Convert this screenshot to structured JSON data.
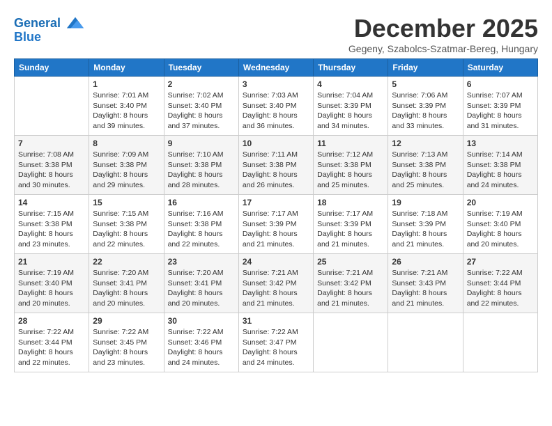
{
  "header": {
    "logo_line1": "General",
    "logo_line2": "Blue",
    "title": "December 2025",
    "subtitle": "Gegeny, Szabolcs-Szatmar-Bereg, Hungary"
  },
  "days_of_week": [
    "Sunday",
    "Monday",
    "Tuesday",
    "Wednesday",
    "Thursday",
    "Friday",
    "Saturday"
  ],
  "weeks": [
    [
      {
        "day": "",
        "info": ""
      },
      {
        "day": "1",
        "info": "Sunrise: 7:01 AM\nSunset: 3:40 PM\nDaylight: 8 hours\nand 39 minutes."
      },
      {
        "day": "2",
        "info": "Sunrise: 7:02 AM\nSunset: 3:40 PM\nDaylight: 8 hours\nand 37 minutes."
      },
      {
        "day": "3",
        "info": "Sunrise: 7:03 AM\nSunset: 3:40 PM\nDaylight: 8 hours\nand 36 minutes."
      },
      {
        "day": "4",
        "info": "Sunrise: 7:04 AM\nSunset: 3:39 PM\nDaylight: 8 hours\nand 34 minutes."
      },
      {
        "day": "5",
        "info": "Sunrise: 7:06 AM\nSunset: 3:39 PM\nDaylight: 8 hours\nand 33 minutes."
      },
      {
        "day": "6",
        "info": "Sunrise: 7:07 AM\nSunset: 3:39 PM\nDaylight: 8 hours\nand 31 minutes."
      }
    ],
    [
      {
        "day": "7",
        "info": "Sunrise: 7:08 AM\nSunset: 3:38 PM\nDaylight: 8 hours\nand 30 minutes."
      },
      {
        "day": "8",
        "info": "Sunrise: 7:09 AM\nSunset: 3:38 PM\nDaylight: 8 hours\nand 29 minutes."
      },
      {
        "day": "9",
        "info": "Sunrise: 7:10 AM\nSunset: 3:38 PM\nDaylight: 8 hours\nand 28 minutes."
      },
      {
        "day": "10",
        "info": "Sunrise: 7:11 AM\nSunset: 3:38 PM\nDaylight: 8 hours\nand 26 minutes."
      },
      {
        "day": "11",
        "info": "Sunrise: 7:12 AM\nSunset: 3:38 PM\nDaylight: 8 hours\nand 25 minutes."
      },
      {
        "day": "12",
        "info": "Sunrise: 7:13 AM\nSunset: 3:38 PM\nDaylight: 8 hours\nand 25 minutes."
      },
      {
        "day": "13",
        "info": "Sunrise: 7:14 AM\nSunset: 3:38 PM\nDaylight: 8 hours\nand 24 minutes."
      }
    ],
    [
      {
        "day": "14",
        "info": "Sunrise: 7:15 AM\nSunset: 3:38 PM\nDaylight: 8 hours\nand 23 minutes."
      },
      {
        "day": "15",
        "info": "Sunrise: 7:15 AM\nSunset: 3:38 PM\nDaylight: 8 hours\nand 22 minutes."
      },
      {
        "day": "16",
        "info": "Sunrise: 7:16 AM\nSunset: 3:38 PM\nDaylight: 8 hours\nand 22 minutes."
      },
      {
        "day": "17",
        "info": "Sunrise: 7:17 AM\nSunset: 3:39 PM\nDaylight: 8 hours\nand 21 minutes."
      },
      {
        "day": "18",
        "info": "Sunrise: 7:17 AM\nSunset: 3:39 PM\nDaylight: 8 hours\nand 21 minutes."
      },
      {
        "day": "19",
        "info": "Sunrise: 7:18 AM\nSunset: 3:39 PM\nDaylight: 8 hours\nand 21 minutes."
      },
      {
        "day": "20",
        "info": "Sunrise: 7:19 AM\nSunset: 3:40 PM\nDaylight: 8 hours\nand 20 minutes."
      }
    ],
    [
      {
        "day": "21",
        "info": "Sunrise: 7:19 AM\nSunset: 3:40 PM\nDaylight: 8 hours\nand 20 minutes."
      },
      {
        "day": "22",
        "info": "Sunrise: 7:20 AM\nSunset: 3:41 PM\nDaylight: 8 hours\nand 20 minutes."
      },
      {
        "day": "23",
        "info": "Sunrise: 7:20 AM\nSunset: 3:41 PM\nDaylight: 8 hours\nand 20 minutes."
      },
      {
        "day": "24",
        "info": "Sunrise: 7:21 AM\nSunset: 3:42 PM\nDaylight: 8 hours\nand 21 minutes."
      },
      {
        "day": "25",
        "info": "Sunrise: 7:21 AM\nSunset: 3:42 PM\nDaylight: 8 hours\nand 21 minutes."
      },
      {
        "day": "26",
        "info": "Sunrise: 7:21 AM\nSunset: 3:43 PM\nDaylight: 8 hours\nand 21 minutes."
      },
      {
        "day": "27",
        "info": "Sunrise: 7:22 AM\nSunset: 3:44 PM\nDaylight: 8 hours\nand 22 minutes."
      }
    ],
    [
      {
        "day": "28",
        "info": "Sunrise: 7:22 AM\nSunset: 3:44 PM\nDaylight: 8 hours\nand 22 minutes."
      },
      {
        "day": "29",
        "info": "Sunrise: 7:22 AM\nSunset: 3:45 PM\nDaylight: 8 hours\nand 23 minutes."
      },
      {
        "day": "30",
        "info": "Sunrise: 7:22 AM\nSunset: 3:46 PM\nDaylight: 8 hours\nand 24 minutes."
      },
      {
        "day": "31",
        "info": "Sunrise: 7:22 AM\nSunset: 3:47 PM\nDaylight: 8 hours\nand 24 minutes."
      },
      {
        "day": "",
        "info": ""
      },
      {
        "day": "",
        "info": ""
      },
      {
        "day": "",
        "info": ""
      }
    ]
  ]
}
